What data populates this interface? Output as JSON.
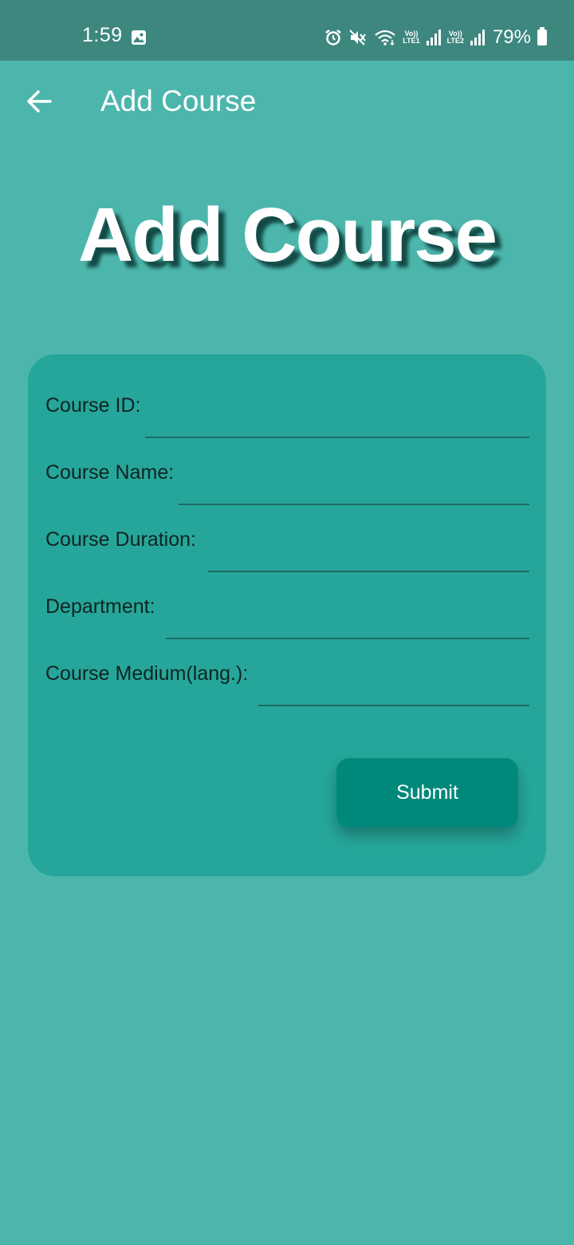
{
  "status_bar": {
    "time": "1:59",
    "battery": "79%",
    "sim1": "LTE1",
    "sim2": "LTE2",
    "volte": "Vo))"
  },
  "app_bar": {
    "title": "Add Course",
    "back_icon": "arrow-left-icon"
  },
  "hero": {
    "title": "Add Course"
  },
  "form": {
    "fields": [
      {
        "label": "Course ID:",
        "value": ""
      },
      {
        "label": "Course Name:",
        "value": ""
      },
      {
        "label": "Course Duration:",
        "value": ""
      },
      {
        "label": "Department:",
        "value": ""
      },
      {
        "label": "Course Medium(lang.):",
        "value": ""
      }
    ],
    "submit_label": "Submit"
  },
  "colors": {
    "status_bar": "#3d877f",
    "background": "#4db6ac",
    "card": "#26a69a",
    "button": "#00897b",
    "hero_shadow": "#134a45"
  }
}
